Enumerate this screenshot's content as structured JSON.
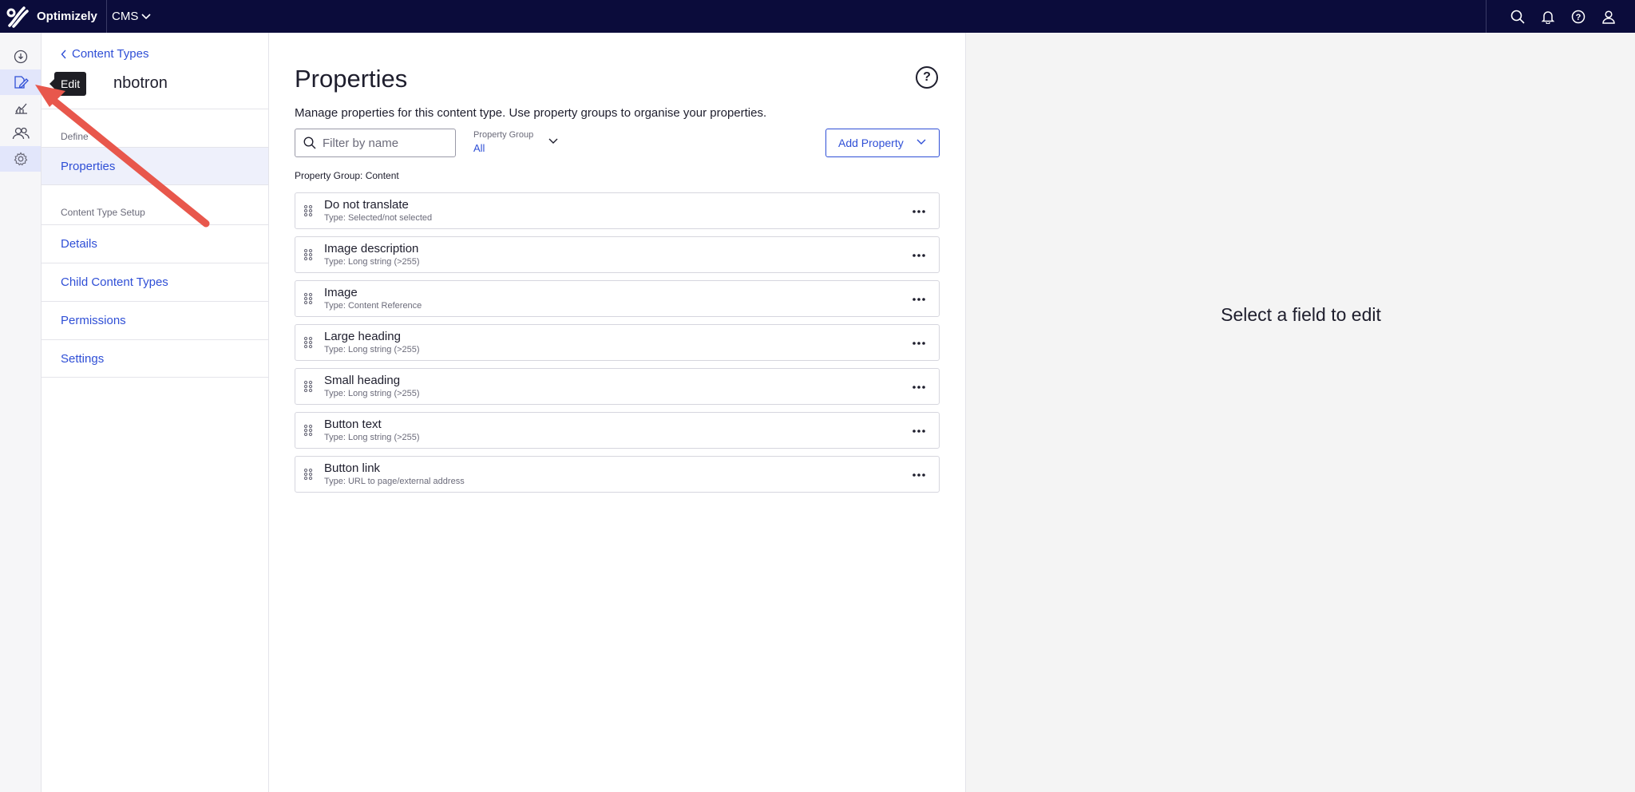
{
  "topbar": {
    "logo_text": "Optimizely",
    "product": "CMS",
    "icons": [
      "search-icon",
      "bell-icon",
      "help-icon",
      "user-icon"
    ]
  },
  "rail": {
    "items": [
      "info-icon",
      "edit-icon",
      "analytics-icon",
      "users-icon",
      "settings-icon"
    ],
    "tooltip": "Edit"
  },
  "subnav": {
    "back_label": "Content Types",
    "content_type_name": "nbotron",
    "define_label": "Define",
    "properties_label": "Properties",
    "setup_label": "Content Type Setup",
    "items": [
      "Details",
      "Child Content Types",
      "Permissions",
      "Settings"
    ]
  },
  "main": {
    "title": "Properties",
    "description": "Manage properties for this content type. Use property groups to organise your properties.",
    "filter_placeholder": "Filter by name",
    "property_group_label": "Property Group",
    "property_group_value": "All",
    "add_property_label": "Add Property",
    "group_heading": "Property Group: Content",
    "properties": [
      {
        "name": "Do not translate",
        "type": "Type: Selected/not selected"
      },
      {
        "name": "Image description",
        "type": "Type: Long string (>255)"
      },
      {
        "name": "Image",
        "type": "Type: Content Reference"
      },
      {
        "name": "Large heading",
        "type": "Type: Long string (>255)"
      },
      {
        "name": "Small heading",
        "type": "Type: Long string (>255)"
      },
      {
        "name": "Button text",
        "type": "Type: Long string (>255)"
      },
      {
        "name": "Button link",
        "type": "Type: URL to page/external address"
      }
    ]
  },
  "right": {
    "empty_message": "Select a field to edit"
  },
  "colors": {
    "topbar": "#0b0c3b",
    "accent": "#2f4fd6",
    "annotation_arrow": "#e8574c"
  }
}
